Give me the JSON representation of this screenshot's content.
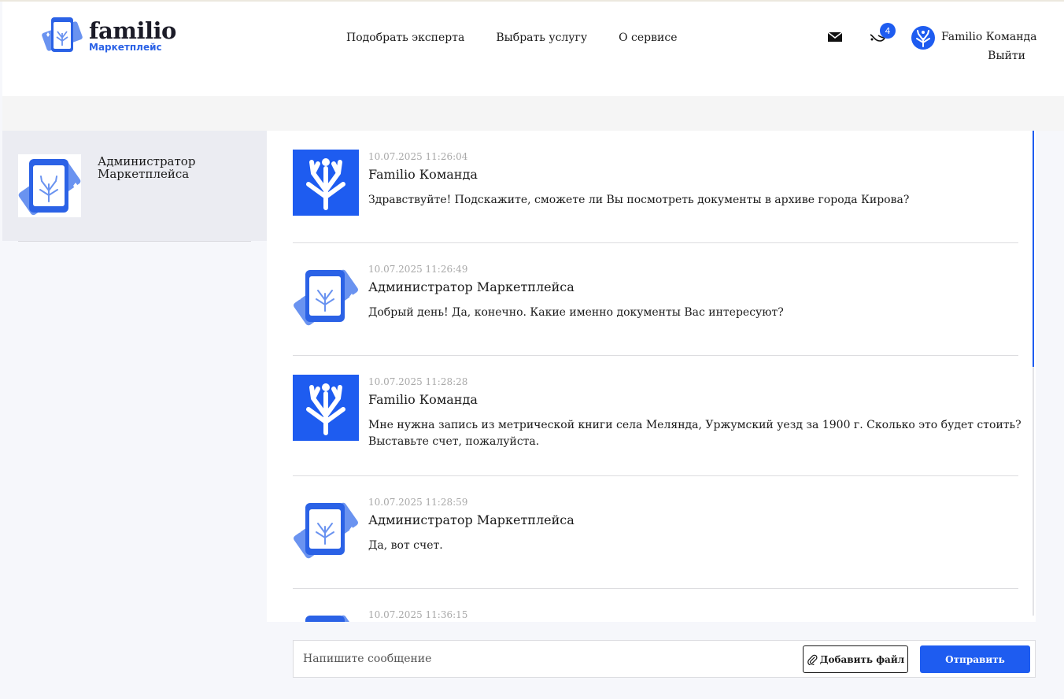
{
  "header": {
    "logo_text": "familio",
    "logo_sub": "Маркетплейс",
    "nav": [
      "Подобрать эксперта",
      "Выбрать услугу",
      "О сервисе"
    ],
    "notifications_count": "4",
    "user_name": "Familio Команда",
    "logout_label": "Выйти",
    "mail_icon": "mail-icon",
    "bell_icon": "bell-icon"
  },
  "sidebar": {
    "contacts": [
      {
        "name": "Администратор Маркетплейса",
        "avatar": "marketplace-logo-icon"
      }
    ]
  },
  "messages": [
    {
      "time": "10.07.2025 11:26:04",
      "author": "Familio Команда",
      "avatar": "team-tree-icon",
      "text": "Здравствуйте! Подскажите, сможете ли Вы посмотреть документы в архиве города Кирова?"
    },
    {
      "time": "10.07.2025 11:26:49",
      "author": "Администратор Маркетплейса",
      "avatar": "marketplace-logo-icon",
      "text": "Добрый день! Да, конечно. Какие именно документы Вас интересуют?"
    },
    {
      "time": "10.07.2025 11:28:28",
      "author": "Familio Команда",
      "avatar": "team-tree-icon",
      "text": "Мне нужна запись из метрической книги села Меляндa, Уржумский уезд за 1900 г. Сколько это будет стоить? Выставьте счет, пожалуйста."
    },
    {
      "time": "10.07.2025 11:28:59",
      "author": "Администратор Маркетплейса",
      "avatar": "marketplace-logo-icon",
      "text": "Да, вот счет."
    },
    {
      "time": "10.07.2025 11:36:15",
      "author": "",
      "avatar": "marketplace-logo-icon",
      "text": ""
    }
  ],
  "composer": {
    "placeholder": "Напишите сообщение",
    "attach_label": "Добавить файл",
    "send_label": "Отправить"
  },
  "colors": {
    "accent": "#1e5cf0",
    "sidebar_active": "#ebecf2",
    "background": "#f6f7fb"
  }
}
